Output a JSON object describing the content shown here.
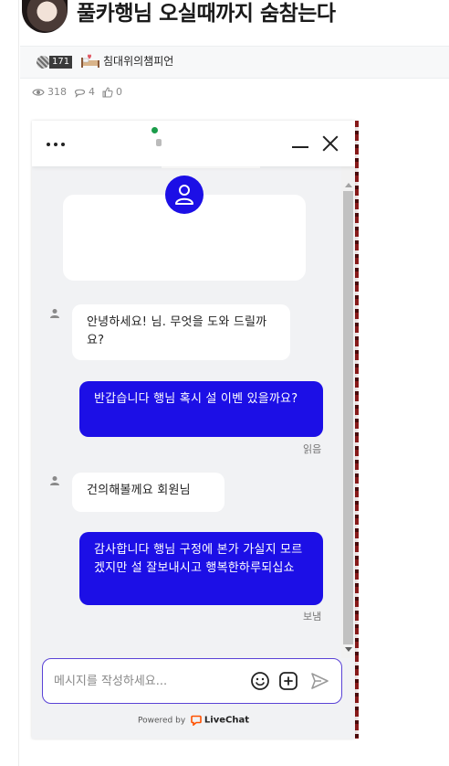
{
  "post": {
    "title": "풀카행님 오실때까지 숨참는다",
    "author": {
      "level": "171",
      "name": "침대위의챔피언"
    },
    "stats": {
      "views": "318",
      "comments": "4",
      "likes": "0"
    }
  },
  "chat": {
    "colors": {
      "accent": "#1c0fe6",
      "background": "#f1f2f4",
      "composer_border": "#5a43d6"
    },
    "messages": [
      {
        "from": "agent",
        "text": "안녕하세요! 님. 무엇을 도와 드릴까요?"
      },
      {
        "from": "user",
        "text": "반갑습니다 행님 혹시 설 이벤 있을까요?",
        "status": "읽음"
      },
      {
        "from": "agent",
        "text": "건의해볼께요 회원님"
      },
      {
        "from": "user",
        "text": "감사합니다 행님 구정에 본가 가실지 모르겠지만 설 잘보내시고 행복한하루되십쇼",
        "status": "보냄"
      }
    ],
    "composer": {
      "placeholder": "메시지를 작성하세요...",
      "value": ""
    },
    "footer": {
      "powered_by": "Powered by",
      "brand": "LiveChat"
    },
    "icons": [
      "menu-dots-icon",
      "minimize-icon",
      "close-icon",
      "user-icon",
      "emoji-icon",
      "add-icon",
      "send-icon",
      "livechat-logo-icon"
    ]
  }
}
